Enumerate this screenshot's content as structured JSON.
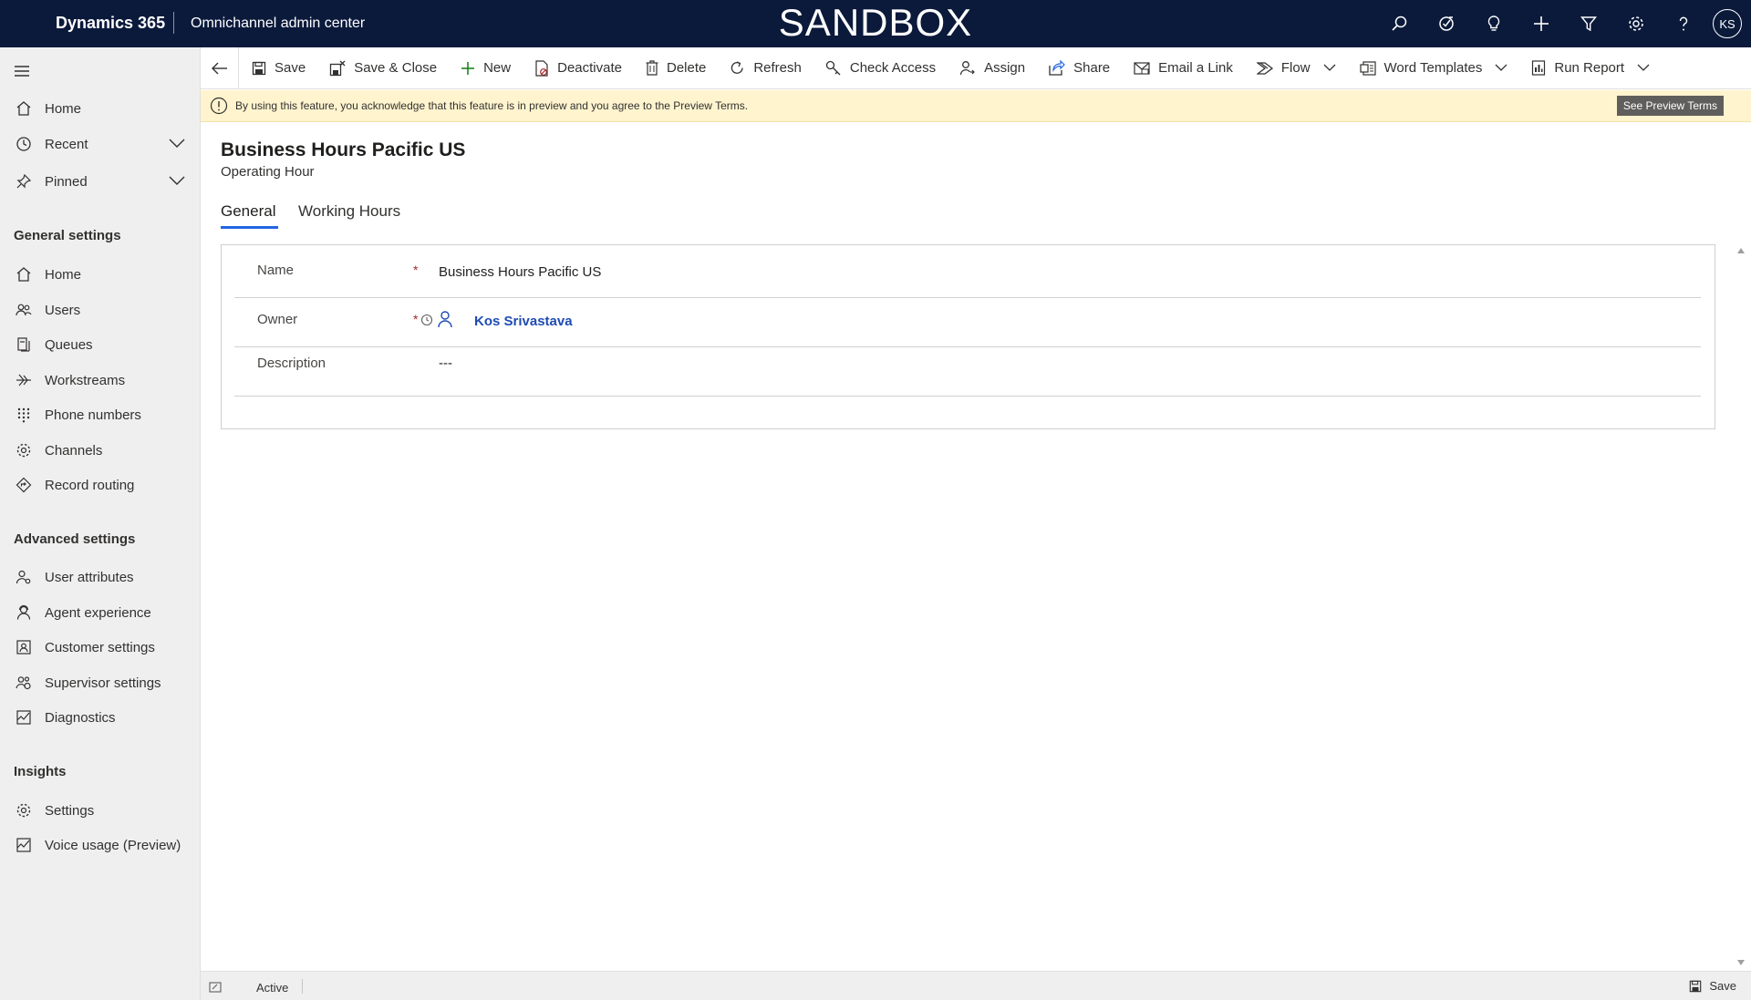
{
  "topbar": {
    "brand": "Dynamics 365",
    "app_name": "Omnichannel admin center",
    "environment_banner": "SANDBOX",
    "icons": [
      "search-icon",
      "task-icon",
      "lightbulb-icon",
      "plus-icon",
      "filter-icon",
      "gear-icon",
      "help-icon"
    ],
    "user_initials": "KS"
  },
  "sidebar": {
    "top_items": [
      {
        "label": "Home",
        "icon": "home-icon"
      },
      {
        "label": "Recent",
        "icon": "clock-icon",
        "expandable": true
      },
      {
        "label": "Pinned",
        "icon": "pin-icon",
        "expandable": true
      }
    ],
    "general_settings": {
      "title": "General settings",
      "items": [
        {
          "label": "Home",
          "icon": "home-icon"
        },
        {
          "label": "Users",
          "icon": "users-icon"
        },
        {
          "label": "Queues",
          "icon": "queue-icon"
        },
        {
          "label": "Workstreams",
          "icon": "workstream-icon"
        },
        {
          "label": "Phone numbers",
          "icon": "dialpad-icon"
        },
        {
          "label": "Channels",
          "icon": "channels-icon"
        },
        {
          "label": "Record routing",
          "icon": "routing-icon"
        }
      ]
    },
    "advanced_settings": {
      "title": "Advanced settings",
      "items": [
        {
          "label": "User attributes",
          "icon": "user-attributes-icon"
        },
        {
          "label": "Agent experience",
          "icon": "agent-icon"
        },
        {
          "label": "Customer settings",
          "icon": "customer-icon"
        },
        {
          "label": "Supervisor settings",
          "icon": "supervisor-icon"
        },
        {
          "label": "Diagnostics",
          "icon": "diagnostics-icon"
        }
      ]
    },
    "insights": {
      "title": "Insights",
      "items": [
        {
          "label": "Settings",
          "icon": "settings-icon"
        },
        {
          "label": "Voice usage (Preview)",
          "icon": "chart-icon"
        }
      ]
    }
  },
  "commandbar": {
    "save": "Save",
    "save_close": "Save & Close",
    "new": "New",
    "deactivate": "Deactivate",
    "delete": "Delete",
    "refresh": "Refresh",
    "check_access": "Check Access",
    "assign": "Assign",
    "share": "Share",
    "email_link": "Email a Link",
    "flow": "Flow",
    "word_templates": "Word Templates",
    "run_report": "Run Report"
  },
  "banner": {
    "text": "By using this feature, you acknowledge that this feature is in preview and you agree to the Preview Terms.",
    "button": "See Preview Terms"
  },
  "record": {
    "title": "Business Hours Pacific US",
    "entity": "Operating Hour",
    "tabs": [
      "General",
      "Working Hours"
    ],
    "active_tab": "General"
  },
  "form": {
    "name_label": "Name",
    "name_value": "Business Hours Pacific US",
    "owner_label": "Owner",
    "owner_value": "Kos Srivastava",
    "description_label": "Description",
    "description_value": "---",
    "required_marker": "*"
  },
  "statusbar": {
    "status": "Active",
    "save": "Save"
  },
  "colors": {
    "topbar_bg": "#0b1a3b",
    "accent": "#2266e3",
    "link": "#1e4bb4",
    "banner_bg": "#fff4ce",
    "required": "#a4262c"
  }
}
